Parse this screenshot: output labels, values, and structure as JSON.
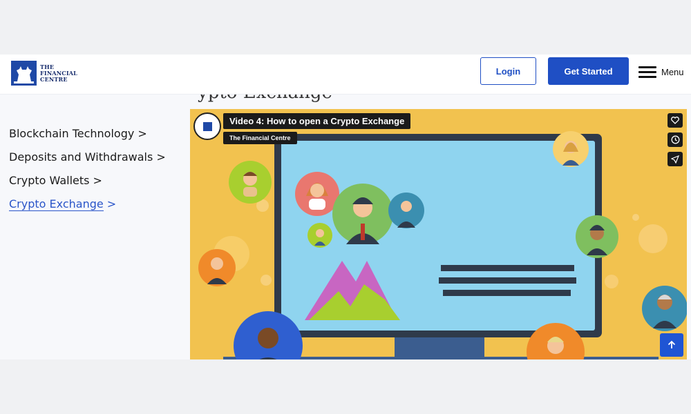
{
  "header": {
    "logo": {
      "line1": "THE",
      "line2": "FINANCIAL",
      "line3": "CENTRE"
    },
    "login_label": "Login",
    "get_started_label": "Get Started",
    "menu_label": "Menu"
  },
  "page_heading_partial": "ypto Exchange",
  "sidebar": {
    "items": [
      {
        "label": "Blockchain Technology",
        "suffix": " >",
        "active": false
      },
      {
        "label": "Deposits and Withdrawals",
        "suffix": " >",
        "active": false
      },
      {
        "label": "Crypto Wallets",
        "suffix": " >",
        "active": false
      },
      {
        "label": "Crypto Exchange",
        "suffix": " >",
        "active": true
      }
    ]
  },
  "video": {
    "title": "Video 4: How to open a Crypto Exchange",
    "channel": "The Financial Centre",
    "controls": [
      "heart-icon",
      "clock-icon",
      "share-icon"
    ]
  },
  "colors": {
    "brand_blue": "#1f4fc4",
    "video_bg": "#f2c24f",
    "screen": "#8fd4ef",
    "active_link": "#2a55c9"
  }
}
